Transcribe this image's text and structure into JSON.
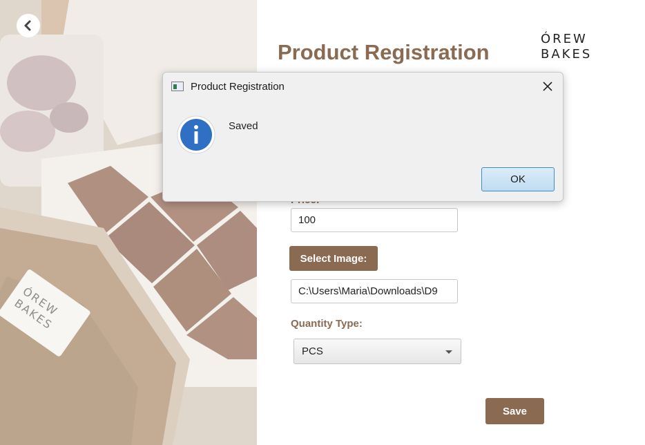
{
  "background_photo": {
    "logo_line1": "ÓREW",
    "logo_line2": "BAKES"
  },
  "header": {
    "title": "Product Registration",
    "logo_line1": "ÓREW",
    "logo_line2": "BAKES"
  },
  "form": {
    "price_label": "Price:",
    "price_value": "100",
    "select_image_label": "Select Image:",
    "image_path_value": "C:\\Users\\Maria\\Downloads\\D9",
    "quantity_type_label": "Quantity Type:",
    "quantity_type_selected": "PCS",
    "save_label": "Save"
  },
  "dialog": {
    "title": "Product Registration",
    "message": "Saved",
    "ok_label": "OK"
  },
  "colors": {
    "accent_brown": "#8b6a52",
    "dialog_bg": "#f0f0f0",
    "ok_button_border": "#3d8ccf",
    "info_icon": "#2f6fc4"
  },
  "icons": {
    "back": "chevron-left-icon",
    "close": "close-icon",
    "info": "info-icon",
    "app": "app-window-icon",
    "dropdown": "chevron-down-icon"
  }
}
